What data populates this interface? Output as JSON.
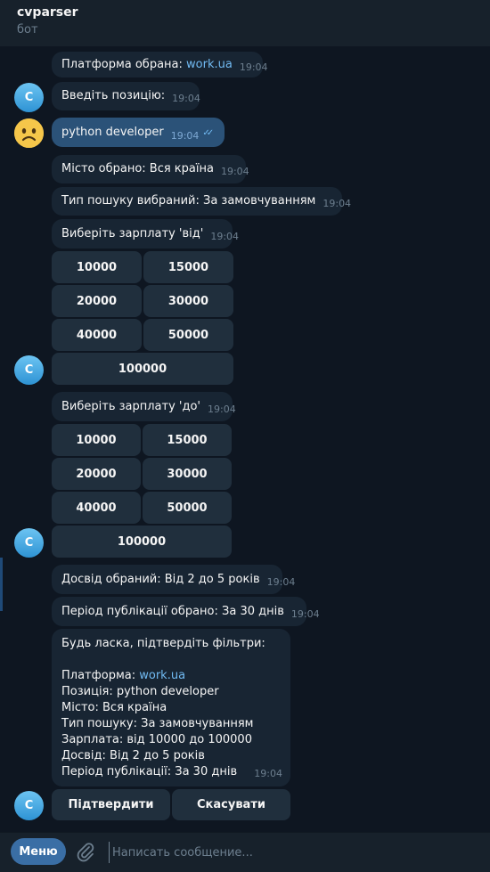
{
  "header": {
    "title": "cvparser",
    "subtitle": "бот"
  },
  "avatars": {
    "bot_letter": "C"
  },
  "messages": {
    "m1": {
      "text": "Платформа обрана: ",
      "link": "work.ua",
      "time": "19:04"
    },
    "m2": {
      "text": "Введіть позицію:",
      "time": "19:04"
    },
    "m3": {
      "text": "python developer",
      "time": "19:04"
    },
    "m4": {
      "text": "Місто обрано: Вся країна",
      "time": "19:04"
    },
    "m5": {
      "text": "Тип пошуку вибраний: За замовчуванням",
      "time": "19:04"
    },
    "m6": {
      "text": "Виберіть зарплату 'від'",
      "time": "19:04"
    },
    "m7": {
      "text": "Виберіть зарплату 'до'",
      "time": "19:04"
    },
    "m8": {
      "text": "Досвід обраний: Від 2 до 5 років",
      "time": "19:04"
    },
    "m9": {
      "text": "Період публікації обрано: За 30 днів",
      "time": "19:04"
    },
    "m10": {
      "line1": "Будь ласка, підтвердіть фільтри:",
      "platform_label": "Платформа: ",
      "platform_link": "work.ua",
      "line3": "Позиція: python developer",
      "line4": "Місто: Вся країна",
      "line5": "Тип пошуку: За замовчуванням",
      "line6": "Зарплата: від 10000 до 100000",
      "line7": "Досвід: Від 2 до 5 років",
      "line8": "Період публікації: За 30 днів",
      "time": "19:04"
    }
  },
  "salary_from_buttons": [
    "10000",
    "15000",
    "20000",
    "30000",
    "40000",
    "50000",
    "100000"
  ],
  "salary_to_buttons": [
    "10000",
    "15000",
    "20000",
    "30000",
    "40000",
    "50000",
    "100000"
  ],
  "confirm_buttons": {
    "confirm": "Підтвердити",
    "cancel": "Скасувати"
  },
  "footer": {
    "menu_label": "Меню",
    "input_placeholder": "Написать сообщение...",
    "input_value": ""
  },
  "colors": {
    "background": "#0e1621",
    "panel": "#17212b",
    "incoming_bubble": "#182533",
    "outgoing_bubble": "#2b5278",
    "keyboard_button": "#202f3d",
    "link": "#71baf2",
    "menu_button": "#3a6ea5"
  },
  "icons": {
    "attach": "paperclip-icon",
    "read_status": "double-check-icon",
    "user_avatar": "unamused-face-icon"
  }
}
